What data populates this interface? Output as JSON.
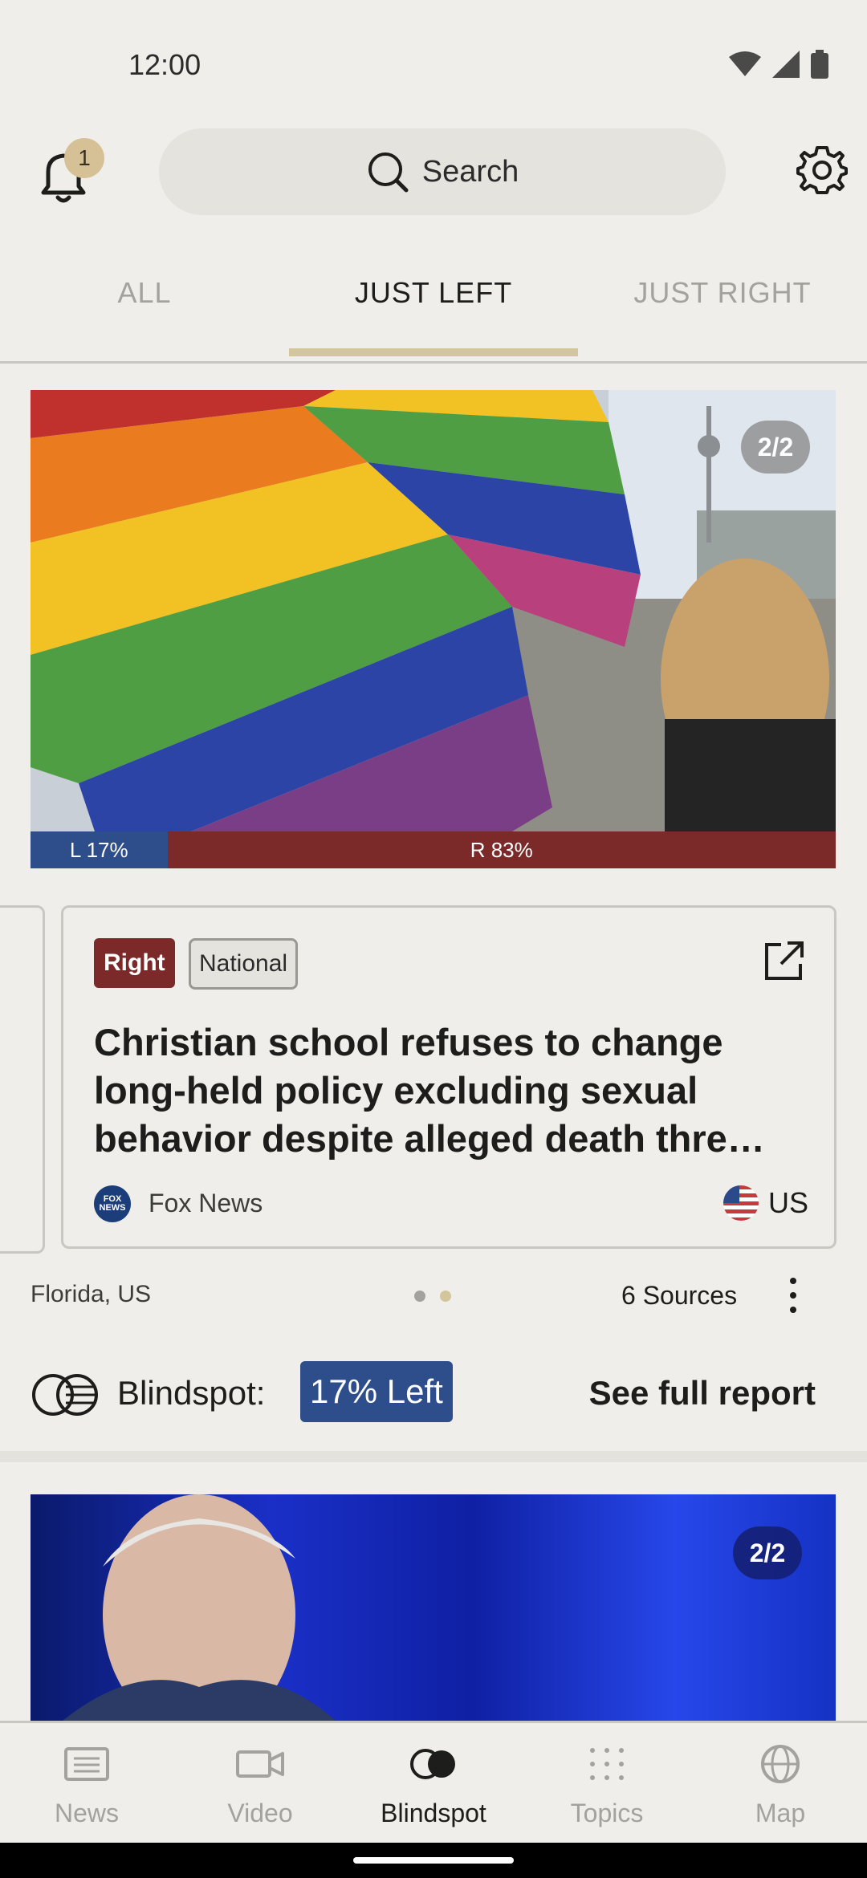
{
  "status_bar": {
    "time": "12:00"
  },
  "topbar": {
    "notification_count": "1",
    "search_label": "Search"
  },
  "tabs": [
    {
      "label": "ALL"
    },
    {
      "label": "JUST LEFT"
    },
    {
      "label": "JUST RIGHT"
    }
  ],
  "active_tab": "JUST LEFT",
  "story": {
    "image_counter": "2/2",
    "bias_left_label": "L 17%",
    "bias_right_label": "R 83%",
    "bias_left_percent": 17,
    "bias_right_percent": 83,
    "tag_lean": "Right",
    "tag_scope": "National",
    "headline": "Christian school refuses to change long-held policy excluding sexual behavior despite alleged death thre…",
    "source_logo_text": "FOX NEWS",
    "source_name": "Fox News",
    "country": "US",
    "location": "Florida, US",
    "sources_count": "6 Sources",
    "carousel_pages": 2,
    "carousel_active": 2,
    "blindspot_label": "Blindspot:",
    "blindspot_value": "17% Left",
    "full_report_label": "See full report"
  },
  "story2": {
    "image_counter": "2/2"
  },
  "bottom_nav": [
    {
      "label": "News",
      "icon": "newspaper-icon"
    },
    {
      "label": "Video",
      "icon": "video-camera-icon"
    },
    {
      "label": "Blindspot",
      "icon": "blindspot-icon"
    },
    {
      "label": "Topics",
      "icon": "grid-dots-icon"
    },
    {
      "label": "Map",
      "icon": "globe-icon"
    }
  ],
  "colors": {
    "background": "#efeeea",
    "left": "#2d4d8b",
    "right": "#7b2a29",
    "accent": "#d3c59c"
  }
}
